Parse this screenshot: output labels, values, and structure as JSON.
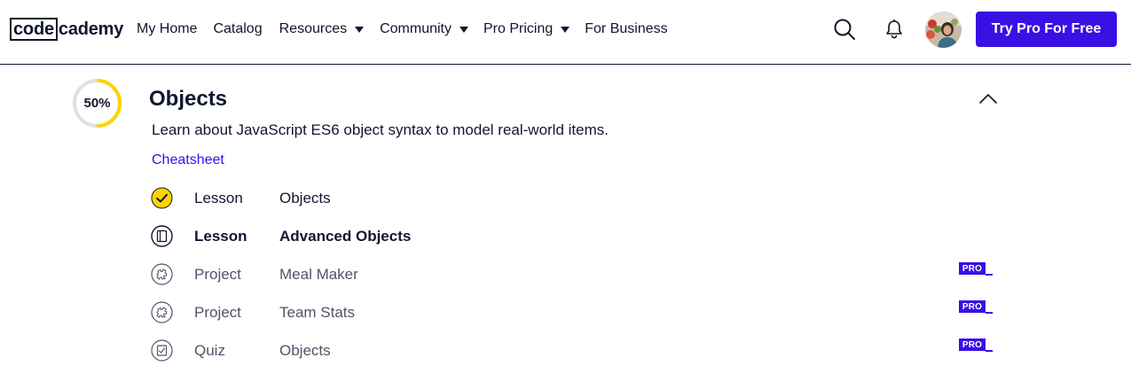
{
  "header": {
    "logo": {
      "boxed": "code",
      "rest": "cademy"
    },
    "nav": [
      {
        "label": "My Home",
        "has_caret": false
      },
      {
        "label": "Catalog",
        "has_caret": false
      },
      {
        "label": "Resources",
        "has_caret": true
      },
      {
        "label": "Community",
        "has_caret": true
      },
      {
        "label": "Pro Pricing",
        "has_caret": true
      },
      {
        "label": "For Business",
        "has_caret": false
      }
    ],
    "icons": {
      "search": "search-icon",
      "notifications": "bell-icon"
    },
    "cta_label": "Try Pro For Free"
  },
  "module": {
    "progress_label": "50%",
    "progress_value": 0.5,
    "title": "Objects",
    "description": "Learn about JavaScript ES6 object syntax to model real-world items.",
    "cheatsheet_label": "Cheatsheet",
    "items": [
      {
        "type": "Lesson",
        "title": "Objects",
        "status": "completed",
        "icon": "check-circle-icon",
        "pro": false
      },
      {
        "type": "Lesson",
        "title": "Advanced Objects",
        "status": "current",
        "icon": "lesson-icon",
        "pro": false
      },
      {
        "type": "Project",
        "title": "Meal Maker",
        "status": "locked",
        "icon": "project-icon",
        "pro": true
      },
      {
        "type": "Project",
        "title": "Team Stats",
        "status": "locked",
        "icon": "project-icon",
        "pro": true
      },
      {
        "type": "Quiz",
        "title": "Objects",
        "status": "locked",
        "icon": "quiz-icon",
        "pro": true
      }
    ],
    "pro_badge_label": "PRO"
  },
  "colors": {
    "brand": "#3a10e5",
    "navy": "#10162f",
    "progress": "#ffd300",
    "track": "#e0e0e0"
  }
}
